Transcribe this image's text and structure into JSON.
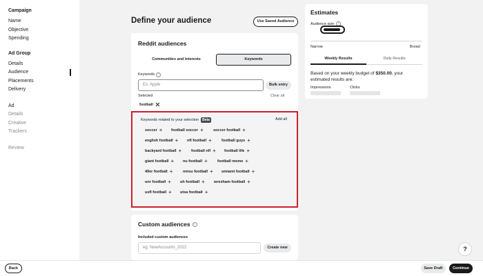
{
  "sidebar": {
    "campaign_head": "Campaign",
    "campaign_items": [
      "Name",
      "Objective",
      "Spending"
    ],
    "adgroup_head": "Ad Group",
    "adgroup_items": [
      "Details",
      "Audience",
      "Placements",
      "Delivery"
    ],
    "ad_head": "Ad",
    "ad_items": [
      "Details",
      "Creative",
      "Trackers"
    ],
    "review": "Review"
  },
  "main": {
    "title": "Define your audience",
    "saved_button": "Use Saved Audience"
  },
  "reddit": {
    "title": "Reddit audiences",
    "tabs": [
      "Communities and Interests",
      "Keywords"
    ],
    "keywords_label": "Keywords",
    "keywords_placeholder": "Ex. Apple",
    "bulk_button": "Bulk entry",
    "selected_label": "Selected",
    "clear_all": "Clear all",
    "selected_chip": "football",
    "related_label": "Keywords related to your selection",
    "beta_badge": "Beta",
    "add_all": "Add all",
    "suggestions": [
      [
        "soccer",
        "football soccer",
        "soccer football"
      ],
      [
        "english football",
        "nfl football",
        "football guys"
      ],
      [
        "backyard football",
        "football nfl",
        "football life"
      ],
      [
        "giant football",
        "nu football",
        "football meme"
      ],
      [
        "49er football",
        "nmsu football",
        "umiami football"
      ],
      [
        "unr football",
        "uh football",
        "wrexham football"
      ],
      [
        "usfl football",
        "utsa football"
      ]
    ]
  },
  "custom": {
    "title": "Custom audiences",
    "included_label": "Included custom audiences",
    "placeholder": "eg. NewAccounts_2022",
    "create_button": "Create new"
  },
  "estimates": {
    "title": "Estimates",
    "audience_size_label": "Audience size",
    "narrow": "Narrow",
    "broad": "Broad",
    "tabs": [
      "Weekly Results",
      "Daily Results"
    ],
    "budget_prefix": "Based on your weekly budget of ",
    "budget_amount": "$350.00",
    "budget_suffix": ", your estimated results are:",
    "impressions_label": "Impressions",
    "clicks_label": "Clicks"
  },
  "footer": {
    "back": "Back",
    "save_draft": "Save Draft",
    "continue": "Continue",
    "help": "?"
  },
  "colors": {
    "highlight_border": "#cc1f2a",
    "primary_button": "#1a1a1b"
  }
}
